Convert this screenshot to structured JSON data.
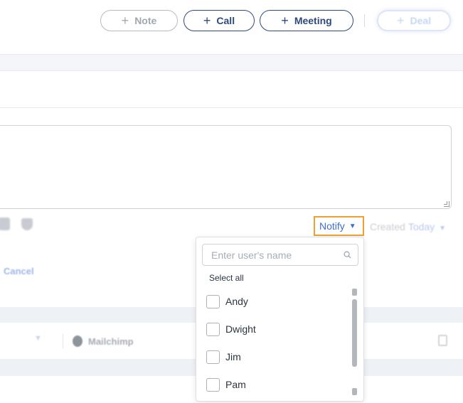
{
  "toolbar": {
    "note_label": "Note",
    "call_label": "Call",
    "meeting_label": "Meeting",
    "deal_label": "Deal",
    "plus_glyph": "+"
  },
  "composer": {
    "notify_label": "Notify",
    "created_label": "Created",
    "created_value": "Today",
    "cancel_label": "Cancel"
  },
  "activity_row": {
    "source_label": "Mailchimp"
  },
  "notify_dropdown": {
    "search_placeholder": "Enter user's name",
    "select_all_label": "Select all",
    "users": [
      {
        "name": "Andy",
        "checked": false
      },
      {
        "name": "Dwight",
        "checked": false
      },
      {
        "name": "Jim",
        "checked": false
      },
      {
        "name": "Pam",
        "checked": false
      }
    ]
  },
  "colors": {
    "primary": "#2e4a7d",
    "link": "#3b6fd0",
    "focus_outline": "#f0a030"
  }
}
